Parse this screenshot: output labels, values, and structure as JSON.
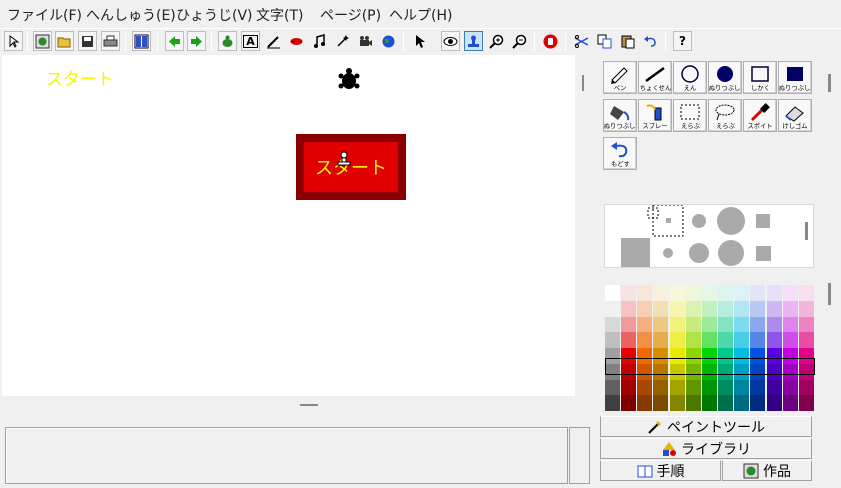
{
  "menu": [
    "ファイル(F)",
    "へんしゅう(E)",
    "ひょうじ(V)",
    "文字(T)",
    "ページ(P)",
    "ヘルプ(H)"
  ],
  "toolbar": {
    "help_label": "?",
    "text_tool_label": "A"
  },
  "canvas": {
    "sprite_text": "スタート",
    "button_text": "スタート"
  },
  "tools": [
    {
      "label": "ペン",
      "icon": "pen-icon"
    },
    {
      "label": "ちょくせん",
      "icon": "line-icon"
    },
    {
      "label": "えん",
      "icon": "circle-icon"
    },
    {
      "label": "ぬりつぶし",
      "icon": "filled-circle-icon"
    },
    {
      "label": "しかく",
      "icon": "rectangle-icon"
    },
    {
      "label": "ぬりつぶし",
      "icon": "filled-rectangle-icon"
    },
    {
      "label": "ぬりつぶし",
      "icon": "paint-bucket-icon"
    },
    {
      "label": "スプレー",
      "icon": "spray-icon"
    },
    {
      "label": "えらぶ",
      "icon": "rect-select-icon"
    },
    {
      "label": "えらぶ",
      "icon": "lasso-select-icon"
    },
    {
      "label": "スポイト",
      "icon": "eyedropper-icon"
    },
    {
      "label": "けしゴム",
      "icon": "eraser-icon"
    },
    {
      "label": "もどす",
      "icon": "undo-icon"
    }
  ],
  "tabs": {
    "paint_tools": "ペイントツール",
    "library": "ライブラリ",
    "procedure": "手順",
    "works": "作品"
  },
  "colors": {
    "canvas_background": "#ffffff",
    "sprite_text": "#f6f600",
    "button_fill": "#e00000",
    "button_border": "#8a0000"
  }
}
